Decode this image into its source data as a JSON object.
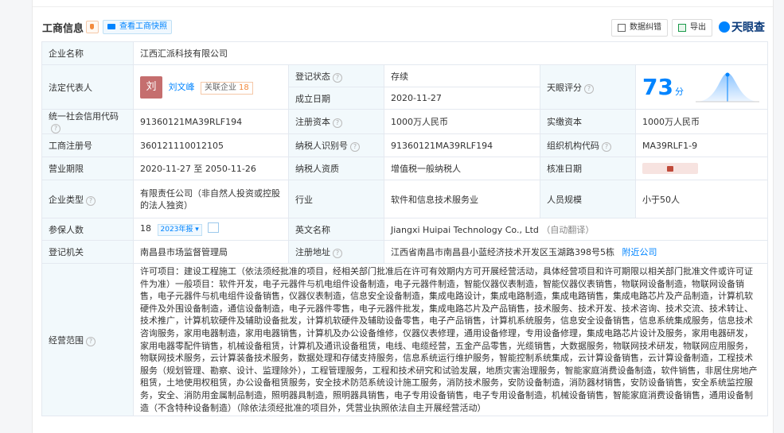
{
  "header": {
    "title": "工商信息",
    "snapshot_label": "查看工商快照",
    "correction_label": "数据纠错",
    "export_label": "导出",
    "logo_text": "天眼查"
  },
  "labels": {
    "company_name": "企业名称",
    "legal_rep": "法定代表人",
    "reg_status": "登记状态",
    "founded": "成立日期",
    "tyc_score": "天眼评分",
    "credit_code": "统一社会信用代码",
    "reg_capital": "注册资本",
    "paid_capital": "实缴资本",
    "biz_reg_no": "工商注册号",
    "taxpayer_id": "纳税人识别号",
    "org_code": "组织机构代码",
    "biz_term": "营业期限",
    "taxpayer_qual": "纳税人资质",
    "approval_date": "核准日期",
    "company_type": "企业类型",
    "industry": "行业",
    "staff_size": "人员规模",
    "insured": "参保人数",
    "english_name": "英文名称",
    "reg_authority": "登记机关",
    "reg_address": "注册地址",
    "biz_scope": "经营范围"
  },
  "values": {
    "company_name": "江西汇派科技有限公司",
    "legal_rep_avatar": "刘",
    "legal_rep_name": "刘文峰",
    "related_label": "关联企业",
    "related_count": "18",
    "reg_status": "存续",
    "founded": "2020-11-27",
    "score": "73",
    "score_unit": "分",
    "credit_code": "91360121MA39RLF194",
    "reg_capital": "1000万人民币",
    "paid_capital": "1000万人民币",
    "biz_reg_no": "360121110012105",
    "taxpayer_id": "91360121MA39RLF194",
    "org_code": "MA39RLF1-9",
    "biz_term": "2020-11-27 至 2050-11-26",
    "taxpayer_qual": "增值税一般纳税人",
    "company_type": "有限责任公司（非自然人投资或控股的法人独资）",
    "industry": "软件和信息技术服务业",
    "staff_size": "小于50人",
    "insured": "18",
    "insured_year": "2023年报",
    "english_name": "Jiangxi Huipai Technology Co., Ltd",
    "english_note": "（自动翻译）",
    "reg_authority": "南昌县市场监督管理局",
    "reg_address": "江西省南昌市南昌县小蓝经济技术开发区玉湖路398号5栋",
    "nearby": "附近公司",
    "biz_scope": "许可项目：建设工程施工（依法须经批准的项目，经相关部门批准后在许可有效期内方可开展经营活动，具体经营项目和许可期限以相关部门批准文件或许可证件为准）一般项目：软件开发，电子元器件与机电组件设备制造，电子元器件制造，智能仪器仪表制造，智能仪器仪表销售，物联网设备制造，物联网设备销售，电子元器件与机电组件设备销售，仪器仪表制造，信息安全设备制造，集成电路设计，集成电路制造，集成电路销售，集成电路芯片及产品制造，计算机软硬件及外围设备制造，通信设备制造，电子元器件零售，电子元器件批发，集成电路芯片及产品销售，技术服务、技术开发、技术咨询、技术交流、技术转让、技术推广，计算机软硬件及辅助设备批发，计算机软硬件及辅助设备零售，电子产品销售，计算机系统服务，信息安全设备销售，信息系统集成服务，信息技术咨询服务，家用电器制造，家用电器销售，计算机及办公设备维修，仪器仪表修理，通用设备修理，专用设备修理，集成电路芯片设计及服务，家用电器研发，家用电器零配件销售，机械设备租赁，计算机及通讯设备租赁，电线、电缆经营，五金产品零售，光缆销售，大数据服务，物联网技术研发，物联网应用服务，物联网技术服务，云计算装备技术服务，数据处理和存储支持服务，信息系统运行维护服务，智能控制系统集成，云计算设备销售，云计算设备制造，工程技术服务（规划管理、勘察、设计、监理除外），工程管理服务，工程和技术研究和试验发展，地质灾害治理服务，智能家庭消费设备制造，软件销售，非居住房地产租赁，土地使用权租赁，办公设备租赁服务，安全技术防范系统设计施工服务，消防技术服务，安防设备制造，消防器材销售，安防设备销售，安全系统监控服务，安全、消防用金属制品制造，照明器具制造，照明器具销售，电子专用设备销售，电子专用设备制造，机械设备销售，智能家庭消费设备销售，通用设备制造（不含特种设备制造）（除依法须经批准的项目外，凭营业执照依法自主开展经营活动）"
  },
  "colors": {
    "accent": "#0084ff",
    "status_green": "#00a85a",
    "label_bg": "#f2f9fc"
  }
}
